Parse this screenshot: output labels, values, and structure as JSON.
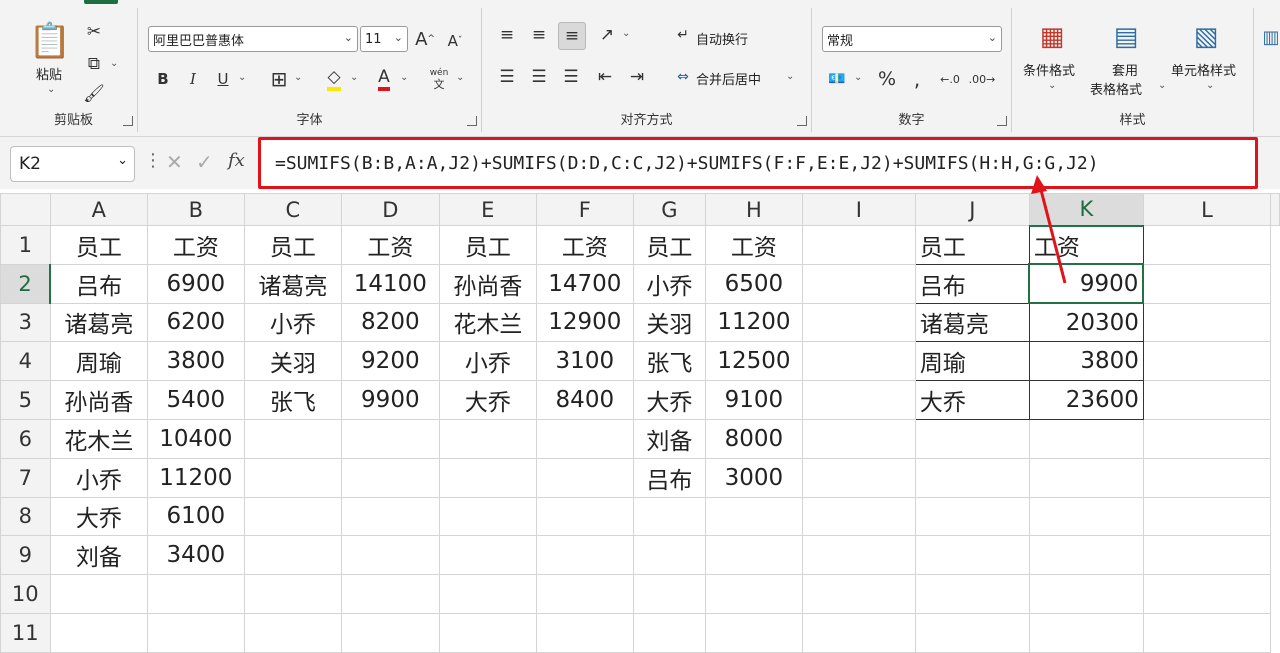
{
  "clipboard": {
    "paste_label": "粘贴",
    "group_label": "剪贴板"
  },
  "font": {
    "name": "阿里巴巴普惠体",
    "size": "11",
    "bold": "B",
    "italic": "I",
    "underline": "U",
    "color_letter": "A",
    "phonetic_top": "wén",
    "phonetic_bottom": "文",
    "grow": "A",
    "shrink": "A",
    "group_label": "字体"
  },
  "alignment": {
    "wrap_label": "自动换行",
    "merge_label": "合并后居中",
    "group_label": "对齐方式"
  },
  "number": {
    "format": "常规",
    "percent": "%",
    "group_label": "数字"
  },
  "styles": {
    "cond_label": "条件格式",
    "table_label_1": "套用",
    "table_label_2": "表格格式",
    "cell_label": "单元格样式",
    "group_label": "样式"
  },
  "formula_bar": {
    "name_box": "K2",
    "fx": "fx",
    "formula": "=SUMIFS(B:B,A:A,J2)+SUMIFS(D:D,C:C,J2)+SUMIFS(F:F,E:E,J2)+SUMIFS(H:H,G:G,J2)"
  },
  "sheet": {
    "columns": [
      "A",
      "B",
      "C",
      "D",
      "E",
      "F",
      "G",
      "H",
      "I",
      "J",
      "K",
      "L"
    ],
    "rows": [
      [
        "1",
        "员工",
        "工资",
        "员工",
        "工资",
        "员工",
        "工资",
        "员工",
        "工资",
        "",
        "员工",
        "工资",
        ""
      ],
      [
        "2",
        "吕布",
        "6900",
        "诸葛亮",
        "14100",
        "孙尚香",
        "14700",
        "小乔",
        "6500",
        "",
        "吕布",
        "9900",
        ""
      ],
      [
        "3",
        "诸葛亮",
        "6200",
        "小乔",
        "8200",
        "花木兰",
        "12900",
        "关羽",
        "11200",
        "",
        "诸葛亮",
        "20300",
        ""
      ],
      [
        "4",
        "周瑜",
        "3800",
        "关羽",
        "9200",
        "小乔",
        "3100",
        "张飞",
        "12500",
        "",
        "周瑜",
        "3800",
        ""
      ],
      [
        "5",
        "孙尚香",
        "5400",
        "张飞",
        "9900",
        "大乔",
        "8400",
        "大乔",
        "9100",
        "",
        "大乔",
        "23600",
        ""
      ],
      [
        "6",
        "花木兰",
        "10400",
        "",
        "",
        "",
        "",
        "刘备",
        "8000",
        "",
        "",
        "",
        ""
      ],
      [
        "7",
        "小乔",
        "11200",
        "",
        "",
        "",
        "",
        "吕布",
        "3000",
        "",
        "",
        "",
        ""
      ],
      [
        "8",
        "大乔",
        "6100",
        "",
        "",
        "",
        "",
        "",
        "",
        "",
        "",
        "",
        ""
      ],
      [
        "9",
        "刘备",
        "3400",
        "",
        "",
        "",
        "",
        "",
        "",
        "",
        "",
        "",
        ""
      ],
      [
        "10",
        "",
        "",
        "",
        "",
        "",
        "",
        "",
        "",
        "",
        "",
        "",
        ""
      ],
      [
        "11",
        "",
        "",
        "",
        "",
        "",
        "",
        "",
        "",
        "",
        "",
        "",
        ""
      ]
    ]
  },
  "colors": {
    "accent": "#217346",
    "highlight": "#e0121a"
  }
}
